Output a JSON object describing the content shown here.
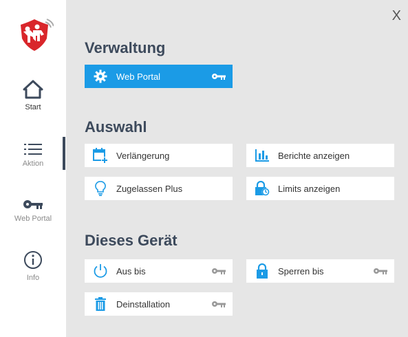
{
  "window": {
    "close_label": "X"
  },
  "sidebar": {
    "items": [
      {
        "label": "Start",
        "icon": "home-icon"
      },
      {
        "label": "Aktion",
        "icon": "list-icon"
      },
      {
        "label": "Web Portal",
        "icon": "key-icon"
      },
      {
        "label": "Info",
        "icon": "info-icon"
      }
    ]
  },
  "sections": {
    "verwaltung": {
      "title": "Verwaltung",
      "web_portal": "Web Portal"
    },
    "auswahl": {
      "title": "Auswahl",
      "verlaengerung": "Verlängerung",
      "berichte": "Berichte anzeigen",
      "zugelassen": "Zugelassen Plus",
      "limits": "Limits anzeigen"
    },
    "geraet": {
      "title": "Dieses Gerät",
      "aus_bis": "Aus bis",
      "sperren_bis": "Sperren bis",
      "deinstallation": "Deinstallation"
    }
  },
  "colors": {
    "accent": "#1b9be6",
    "title": "#3d4a5c",
    "background": "#e6e6e6",
    "logo_red": "#d9262b",
    "key_gray": "#9a9a9a"
  }
}
